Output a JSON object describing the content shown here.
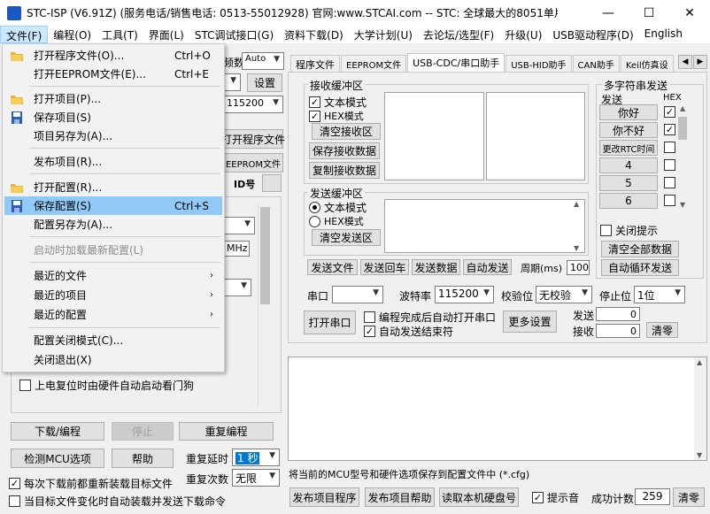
{
  "title": "STC-ISP (V6.91Z) (服务电话/销售电话: 0513-55012928) 官网:www.STCAI.com  -- STC: 全球最大的8051单片机设...",
  "window_controls": {
    "minimize": "—",
    "maximize": "☐",
    "close": "✕"
  },
  "menubar": [
    "文件(F)",
    "编程(O)",
    "工具(T)",
    "界面(L)",
    "STC调试接口(G)",
    "资料下载(D)",
    "大学计划(U)",
    "去论坛/选型(F)",
    "升级(U)",
    "USB驱动程序(D)",
    "English"
  ],
  "file_menu": {
    "items": [
      {
        "label": "打开程序文件(O)...",
        "shortcut": "Ctrl+O",
        "icon": "folder-icon"
      },
      {
        "label": "打开EEPROM文件(E)...",
        "shortcut": "Ctrl+E",
        "icon": ""
      },
      {
        "label": "打开项目(P)...",
        "shortcut": "",
        "icon": "folder-icon"
      },
      {
        "label": "保存项目(S)",
        "shortcut": "",
        "icon": "floppy-icon"
      },
      {
        "label": "项目另存为(A)...",
        "shortcut": "",
        "icon": ""
      },
      {
        "label": "发布项目(R)...",
        "shortcut": "",
        "icon": ""
      },
      {
        "label": "打开配置(R)...",
        "shortcut": "",
        "icon": "folder-icon"
      },
      {
        "label": "保存配置(S)",
        "shortcut": "Ctrl+S",
        "icon": "floppy-icon"
      },
      {
        "label": "配置另存为(A)...",
        "shortcut": "",
        "icon": ""
      },
      {
        "label": "启动时加载最新配置(L)",
        "shortcut": "",
        "icon": ""
      },
      {
        "label": "最近的文件",
        "shortcut": "",
        "icon": ""
      },
      {
        "label": "最近的项目",
        "shortcut": "",
        "icon": ""
      },
      {
        "label": "最近的配置",
        "shortcut": "",
        "icon": ""
      },
      {
        "label": "配置关闭模式(C)...",
        "shortcut": "",
        "icon": ""
      },
      {
        "label": "关闭退出(X)",
        "shortcut": "",
        "icon": ""
      }
    ],
    "submenu_arrow": "›"
  },
  "left_panel": {
    "freq_label": "频数",
    "auto_value": "Auto",
    "settings_btn": "设置",
    "baud_value": "115200",
    "open_prog_btn": "打开程序文件",
    "open_eeprom_btn": "EEPROM文件",
    "id_label": "ID号",
    "mhz_label": "MHz",
    "watchdog_chk": "上电复位时由硬件自动启动看门狗",
    "download_btn": "下载/编程",
    "stop_btn": "停止",
    "reprogram_btn": "重复编程",
    "check_mcu_btn": "检测MCU选项",
    "help_btn": "帮助",
    "retry_delay_label": "重复延时",
    "retry_delay_value": "1 秒",
    "retry_count_label": "重复次数",
    "retry_count_value": "无限",
    "reload_chk": "每次下载前都重新装载目标文件",
    "autoload_chk": "当目标文件变化时自动装载并发送下载命令"
  },
  "tabs": [
    "程序文件",
    "EEPROM文件",
    "USB-CDC/串口助手",
    "USB-HID助手",
    "CAN助手",
    "Keil仿真设"
  ],
  "recv": {
    "group": "接收缓冲区",
    "text_mode": "文本模式",
    "hex_mode": "HEX模式",
    "clear_btn": "清空接收区",
    "save_btn": "保存接收数据",
    "copy_btn": "复制接收数据"
  },
  "send": {
    "group": "发送缓冲区",
    "text_mode": "文本模式",
    "hex_mode": "HEX模式",
    "clear_btn": "清空发送区",
    "send_file_btn": "发送文件",
    "send_return_btn": "发送回车",
    "send_data_btn": "发送数据",
    "auto_send_btn": "自动发送",
    "period_label": "周期(ms)",
    "period_value": "100"
  },
  "multi": {
    "group": "多字符串发送",
    "send_col": "发送",
    "hex_col": "HEX",
    "rows": [
      {
        "label": "你好",
        "checked": true
      },
      {
        "label": "你不好",
        "checked": true
      },
      {
        "label": "更改RTC时间",
        "checked": false
      },
      {
        "label": "4",
        "checked": false
      },
      {
        "label": "5",
        "checked": false
      },
      {
        "label": "6",
        "checked": false
      }
    ],
    "close_hint_chk": "关闭提示",
    "clear_all_btn": "清空全部数据",
    "auto_loop_btn": "自动循环发送"
  },
  "serial": {
    "port_label": "串口",
    "port_value": "",
    "baud_label": "波特率",
    "baud_value": "115200",
    "parity_label": "校验位",
    "parity_value": "无校验",
    "stop_label": "停止位",
    "stop_value": "1位",
    "open_btn": "打开串口",
    "auto_open_chk": "编程完成后自动打开串口",
    "auto_end_chk": "自动发送结束符",
    "more_btn": "更多设置",
    "send_label": "发送",
    "send_count": "0",
    "recv_label": "接收",
    "recv_count": "0",
    "clear_btn": "清零"
  },
  "status_text": "将当前的MCU型号和硬件选项保存到配置文件中 (*.cfg)",
  "bottom": {
    "publish_prog_btn": "发布项目程序",
    "publish_help_btn": "发布项目帮助",
    "read_disk_btn": "读取本机硬盘号",
    "beep_chk": "提示音",
    "success_label": "成功计数",
    "success_value": "259",
    "clear_btn": "清零"
  },
  "colors": {
    "highlight": "#91c9f7",
    "menu_active": "#cce8ff",
    "accent": "#1a56c4"
  }
}
